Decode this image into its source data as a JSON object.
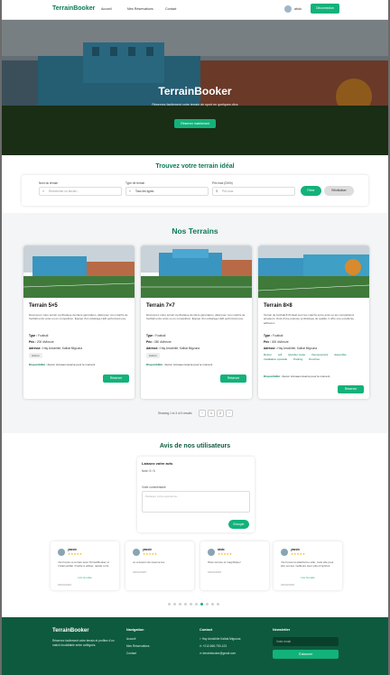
{
  "nav": {
    "brand": "TerrainBooker",
    "links": [
      "Accueil",
      "Mes Réservations",
      "Contact"
    ],
    "user": "abdo",
    "logout": "Déconnexion"
  },
  "hero": {
    "title": "TerrainBooker",
    "subtitle": "Réservez facilement votre terrain de sport en quelques clics",
    "cta": "Réserver maintenant"
  },
  "search": {
    "title": "Trouvez votre terrain idéal",
    "name_label": "Nom du terrain",
    "name_placeholder": "Rechercher un terrain...",
    "type_label": "Type de terrain",
    "type_value": "Tous les types",
    "price_label": "Prix max (DH/h)",
    "price_placeholder": "Prix max",
    "filter": "Filtrer",
    "reset": "Réinitialiser"
  },
  "terrains": {
    "title": "Nos Terrains",
    "cards": [
      {
        "name": "Terrain 5×5",
        "desc": "Découvrez notre terrain synthétique dernière génération, idéal pour vos matchs de football entre amis ou en compétition. Équipé d'un éclairage LED performant pou",
        "type_label": "Type :",
        "type": "Football",
        "price_label": "Prix :",
        "price": "200 dh/heure",
        "addr_label": "Adresse :",
        "addr": "Hay Amokhtie, Kalbat Migouna",
        "tags": [
          "Aucun"
        ],
        "avail_label": "Disponibilité :",
        "avail": "Aucun créneau réservé pour le moment",
        "btn": "Réserver"
      },
      {
        "name": "Terrain 7×7",
        "desc": "Découvrez notre terrain synthétique dernière génération, idéal pour vos matchs de football entre amis ou en compétition. Équipé d'un éclairage LED performant pou",
        "type_label": "Type :",
        "type": "Football",
        "price_label": "Prix :",
        "price": "280 dh/heure",
        "addr_label": "Adresse :",
        "addr": "Hay Amokhtie, Kalbat Migouna",
        "tags": [
          "Aucun"
        ],
        "avail_label": "Disponibilité :",
        "avail": "Aucun créneau réservé pour le moment",
        "btn": "Réserver"
      },
      {
        "name": "Terrain 8×8",
        "desc": "Terrain de football 8×8 idéal pour les matchs entre amis ou les compétitions amateurs. Doté d'une pelouse synthétique de qualité, il offre une excellente adhérenc",
        "type_label": "Type :",
        "type": "Football",
        "price_label": "Prix :",
        "price": "300 dh/heure",
        "addr_label": "Adresse :",
        "addr": "Hay Amokhtie, Kalbat Migouna",
        "tags": [
          "Retour",
          "wifi",
          "Quartier rester",
          "Découvertant",
          "disponible",
          "Installation spéciale",
          "Parking",
          "Douches"
        ],
        "avail_label": "Disponibilité :",
        "avail": "Aucun créneau réservé pour le moment",
        "btn": "Réserver"
      }
    ],
    "pager_text": "Showing 1 to 3 of 4 results",
    "pages": [
      "‹",
      "1",
      "2",
      "›"
    ]
  },
  "reviews": {
    "title": "Avis de nos utilisateurs",
    "form_title": "Laissez votre avis",
    "form_rating": "Note: 5 / 5",
    "comment_label": "Votre commentaire",
    "comment_placeholder": "Partagez votre expérience...",
    "submit": "Envoyer",
    "items": [
      {
        "name": "yassin",
        "stars": "★★★★★",
        "text": "J'ai trouvé ce terrain avec TerrainBooker et c'était parfait ! Facile à utiliser, rapide et ils",
        "more": "Lire la suite",
        "date": "29/04/2025"
      },
      {
        "name": "yassin",
        "stars": "★★★★★",
        "text": "on a besoin de réservé les",
        "more": "",
        "date": "29/04/2025"
      },
      {
        "name": "abdo",
        "stars": "★★★★★",
        "text": "Wow service et magnifique!",
        "more": "",
        "date": "29/04/2025"
      },
      {
        "name": "yassin",
        "stars": "★★★★★",
        "text": "J'ai trouvé la plateforme utile, mais elle peut être encore meilleure avec plus d'options",
        "more": "Lire la suite",
        "date": "29/04/2025"
      }
    ],
    "dots": 10,
    "active_dot": 6
  },
  "footer": {
    "brand": "TerrainBooker",
    "about": "Réservez facilement votre terrain et profitez d'un match inoubliable entre collègues.",
    "nav_title": "Navigation",
    "nav_links": [
      "Accueil",
      "Mes Réservations",
      "Contact"
    ],
    "contact_title": "Contact",
    "contact_lines": [
      "Hay Amokhtie Kalbat Migouna",
      "+212-660-750-123",
      "terrainbooker@gmail.com"
    ],
    "news_title": "Newsletter",
    "news_placeholder": "Votre email",
    "news_btn": "S'abonner"
  },
  "colors": {
    "accent": "#13b27a",
    "brand": "#0b7a55",
    "footer": "#0e5a3f"
  }
}
